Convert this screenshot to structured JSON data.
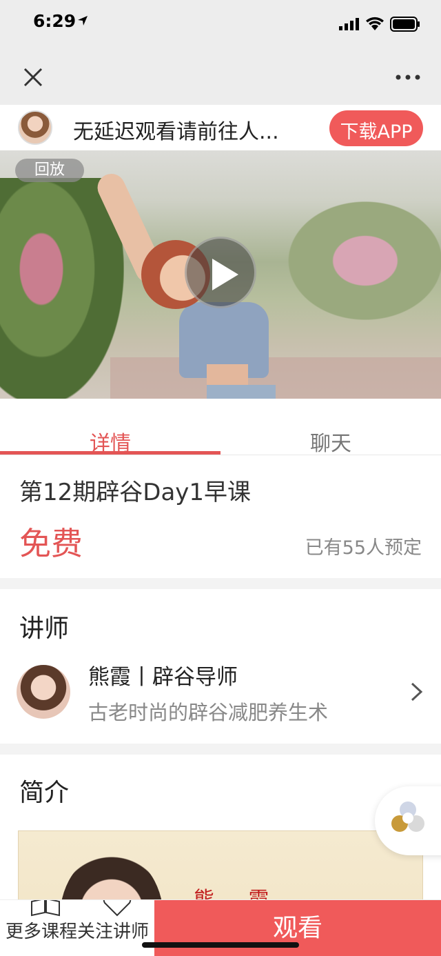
{
  "status_bar": {
    "time": "6:29"
  },
  "banner": {
    "text": "无延迟观看请前往人...",
    "download_label": "下载APP"
  },
  "video": {
    "badge": "回放"
  },
  "tabs": [
    {
      "label": "详情",
      "active": true
    },
    {
      "label": "聊天",
      "active": false
    }
  ],
  "course": {
    "title": "第12期辟谷Day1早课",
    "price": "免费",
    "booked": "已有55人预定"
  },
  "instructor_section": {
    "title": "讲师",
    "name": "熊霞丨辟谷导师",
    "description": "古老时尚的辟谷减肥养生术"
  },
  "intro_section": {
    "title": "简介",
    "image_name": "熊 霞"
  },
  "bottom_bar": {
    "more_courses_label": "更多课程",
    "follow_label": "关注讲师",
    "watch_label": "观看"
  },
  "colors": {
    "accent": "#e35555",
    "button_red": "#f05a5a",
    "nav_bg": "#ededed"
  },
  "icons": [
    "location-arrow-icon",
    "signal-icon",
    "wifi-icon",
    "battery-icon",
    "close-icon",
    "more-icon",
    "play-icon",
    "chevron-right-icon",
    "book-icon",
    "heart-icon",
    "floating-menu-icon"
  ]
}
